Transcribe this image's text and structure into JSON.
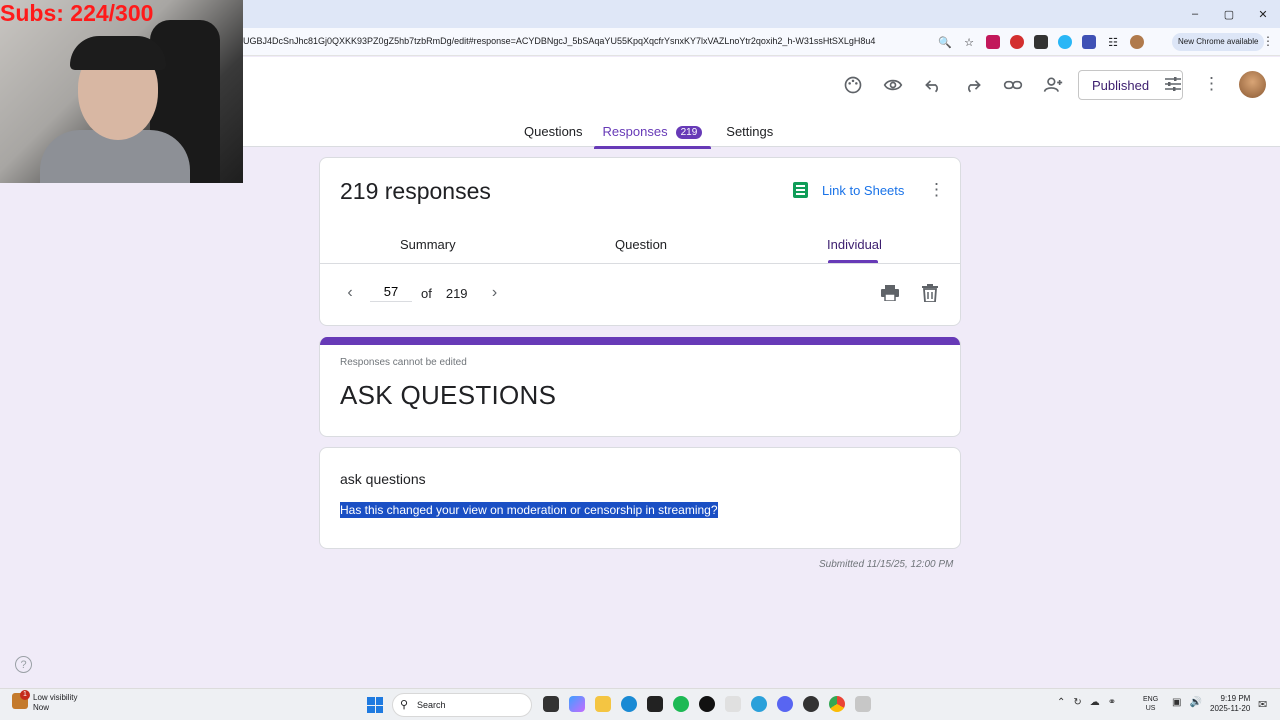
{
  "overlay": {
    "subs_text": "Subs: 224/300"
  },
  "browser": {
    "url": "UGBJ4DcSnJhc81Gj0QXKK93PZ0gZ5hb7tzbRmDg/edit#response=ACYDBNgcJ_5bSAqaYU55KpqXqcfrYsnxKY7lxVAZLnoYtr2qoxih2_h-W31ssHtSXLgH8u4",
    "new_chrome_label": "New Chrome available",
    "window_controls": [
      "–",
      "▢",
      "✕"
    ]
  },
  "header": {
    "published_label": "Published",
    "tabs": [
      {
        "label": "Questions"
      },
      {
        "label": "Responses",
        "badge": "219"
      },
      {
        "label": "Settings"
      }
    ]
  },
  "responses_card": {
    "count_title": "219 responses",
    "link_sheets_label": "Link to Sheets",
    "subtabs": [
      "Summary",
      "Question",
      "Individual"
    ],
    "current_page": "57",
    "of_label": "of",
    "total_pages": "219"
  },
  "form_card": {
    "notice": "Responses cannot be edited",
    "title": "ASK QUESTIONS"
  },
  "question_card": {
    "question": "ask questions",
    "answer": "Has this changed your view on moderation or censorship in streaming?"
  },
  "submitted_text": "Submitted 11/15/25, 12:00 PM",
  "taskbar": {
    "weather_title": "Low visibility",
    "weather_sub": "Now",
    "weather_badge": "1",
    "search_label": "Search",
    "lang_line1": "ENG",
    "lang_line2": "US",
    "time": "9:19 PM",
    "date": "2025-11-20"
  },
  "colors": {
    "accent": "#673ab7",
    "link": "#1a73e8",
    "selection": "#1a4fc4",
    "background": "#f0ebf8"
  }
}
